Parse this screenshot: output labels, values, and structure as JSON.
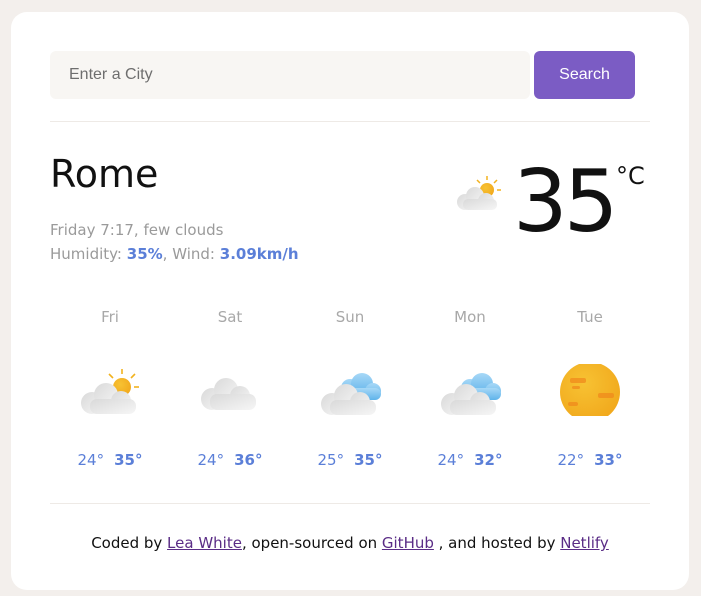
{
  "search": {
    "placeholder": "Enter a City",
    "button_label": "Search"
  },
  "current": {
    "city": "Rome",
    "day_time": "Friday 7:17",
    "description": "few clouds",
    "humidity_label": "Humidity:",
    "humidity": "35%",
    "wind_label": "Wind:",
    "wind": "3.09km/h",
    "temperature": "35",
    "unit": "°C",
    "icon": "sun-behind-cloud-icon"
  },
  "forecast": [
    {
      "day": "Fri",
      "low": "24°",
      "high": "35°",
      "icon": "sun-behind-cloud-icon"
    },
    {
      "day": "Sat",
      "low": "24°",
      "high": "36°",
      "icon": "cloud-icon"
    },
    {
      "day": "Sun",
      "low": "25°",
      "high": "35°",
      "icon": "blue-cloud-icon"
    },
    {
      "day": "Mon",
      "low": "24°",
      "high": "32°",
      "icon": "blue-cloud-icon"
    },
    {
      "day": "Tue",
      "low": "22°",
      "high": "33°",
      "icon": "hazy-sun-icon"
    }
  ],
  "footer": {
    "prefix": "Coded by ",
    "author": "Lea White",
    "middle1": ", open-sourced on ",
    "github": "GitHub",
    "middle2": " , and hosted by ",
    "netlify": "Netlify"
  },
  "colors": {
    "accent": "#7b5cc4",
    "highlight": "#5b7fd8",
    "link": "#5a2c86",
    "background": "#f3efec"
  }
}
